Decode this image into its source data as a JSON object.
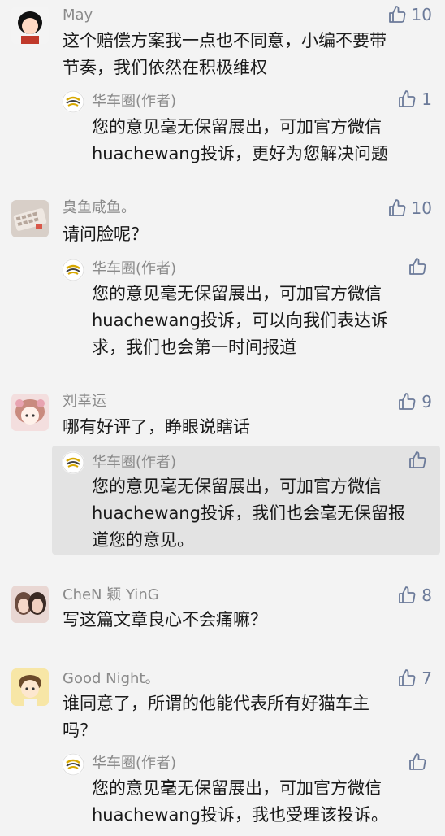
{
  "comments": [
    {
      "user": "May",
      "likes": "10",
      "lines": [
        "这个赔偿方案我一点也不同意，小编不要带",
        "节奏，我们依然在积极维权"
      ],
      "reply": {
        "user": "华车圈(作者)",
        "likes": "1",
        "lines": [
          "您的意见毫无保留展出，可加官方微信",
          "huachewang投诉，更好为您解决问题"
        ]
      }
    },
    {
      "user": "臭鱼咸鱼。",
      "likes": "10",
      "lines": [
        "请问脸呢？"
      ],
      "reply": {
        "user": "华车圈(作者)",
        "likes": "",
        "lines": [
          "您的意见毫无保留展出，可加官方微信",
          "huachewang投诉，可以向我们表达诉",
          "求，我们也会第一时间报道"
        ]
      }
    },
    {
      "user": "刘幸运",
      "likes": "9",
      "lines": [
        "哪有好评了，睁眼说瞎话"
      ],
      "reply": {
        "user": "华车圈(作者)",
        "likes": "",
        "lines": [
          "您的意见毫无保留展出，可加官方微信",
          "huachewang投诉，我们也会毫无保留报",
          "道您的意见。"
        ]
      }
    },
    {
      "user": "CheN 颖 YinG",
      "likes": "8",
      "lines": [
        "写这篇文章良心不会痛嘛？"
      ]
    },
    {
      "user": "Good Night。",
      "likes": "7",
      "lines": [
        "谁同意了，所谓的他能代表所有好猫车主",
        "吗？"
      ],
      "reply": {
        "user": "华车圈(作者)",
        "likes": "",
        "lines": [
          "您的意见毫无保留展出，可加官方微信",
          "huachewang投诉，我也受理该投诉。"
        ]
      }
    }
  ],
  "colors": {
    "background": "#f3f3f3",
    "highlight": "#e3e3e3",
    "like": "#6b7a99"
  },
  "icons": {
    "like": "thumbs-up-icon",
    "author_logo": "huache-logo"
  }
}
